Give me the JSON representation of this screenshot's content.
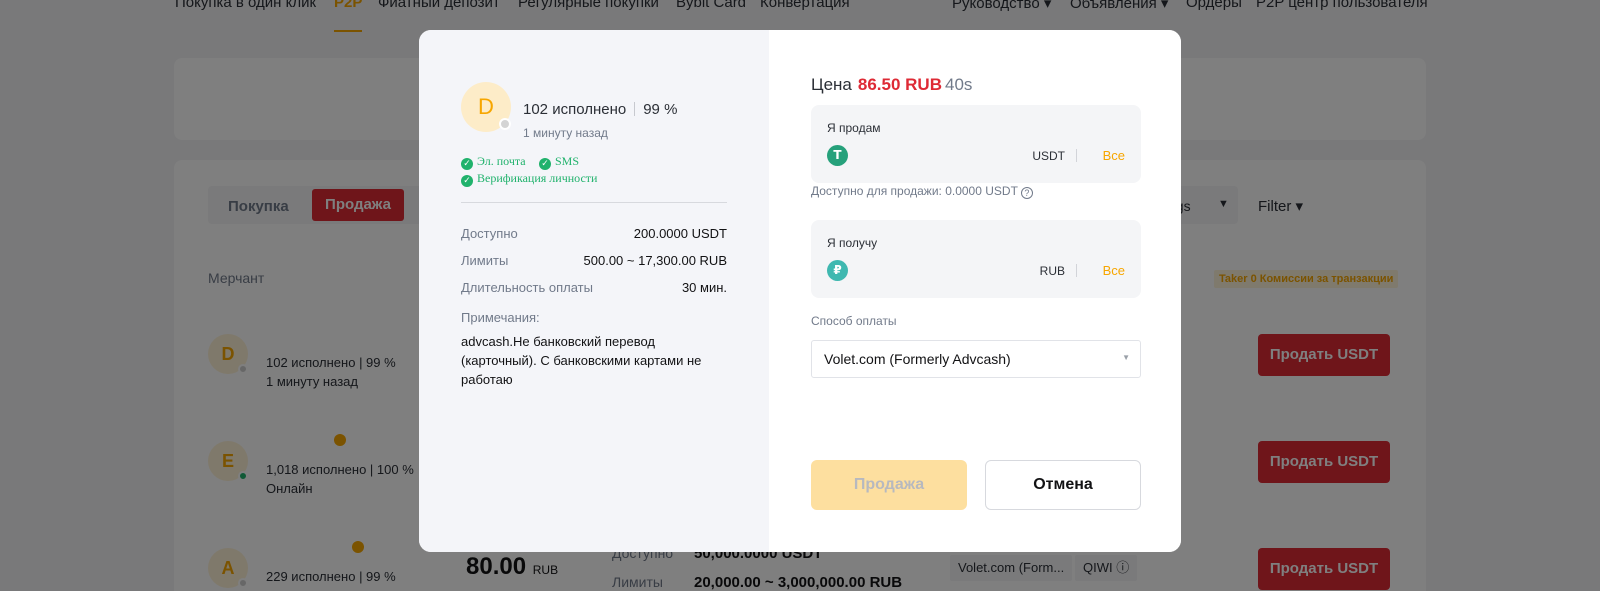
{
  "nav": {
    "items": [
      "Покупка в один клик",
      "P2P",
      "Фиатный депозит",
      "Регулярные покупки",
      "Bybit Card",
      "Конвертация"
    ],
    "right_items": [
      "Руководство ▾",
      "Объявления ▾",
      "Ордеры",
      "P2P центр пользователя"
    ]
  },
  "background": {
    "tabs": {
      "buy": "Покупка",
      "sell": "Продажа"
    },
    "ngs_fragment": "ngs",
    "filter": "Filter ▾",
    "merchant_label": "Мерчант",
    "taker_badge": "Taker 0 Комиссии за транзакции",
    "rows": [
      {
        "initial": "D",
        "stats": "102 исполнено   |   99 %",
        "sub": "1 минуту назад",
        "button": "Продать USDT"
      },
      {
        "initial": "E",
        "stats": "1,018 исполнено   |   100 %",
        "sub": "Онлайн",
        "button": "Продать USDT"
      },
      {
        "initial": "A",
        "stats": "229 исполнено   |   99 %",
        "sub": "",
        "button": "Продать USDT",
        "price": "80.00",
        "price_currency": "RUB",
        "available_label": "Доступно",
        "available_value": "50,000.0000 USDT",
        "limits_label": "Лимиты",
        "limits_value": "20,000.00 ~ 3,000,000.00 RUB",
        "payment_tags": [
          "Volet.com (Form...",
          "QIWI ⓘ"
        ]
      }
    ]
  },
  "modal": {
    "merchant": {
      "initial": "D",
      "orders": "102 исполнено",
      "rate": "99 %",
      "last_seen": "1 минуту назад",
      "verifications": [
        "Эл. почта",
        "SMS",
        "Верификация личности"
      ]
    },
    "info": [
      {
        "label": "Доступно",
        "value": "200.0000 USDT"
      },
      {
        "label": "Лимиты",
        "value": "500.00 ~ 17,300.00 RUB"
      },
      {
        "label": "Длительность оплаты",
        "value": "30 мин."
      }
    ],
    "notes_label": "Примечания:",
    "notes": "advcash.Не банковский перевод (карточный). С банковскими картами не работаю",
    "price_label": "Цена",
    "price_value": "86.50 RUB",
    "timer": "40s",
    "sell_box": {
      "label": "Я продам",
      "value": "",
      "currency": "USDT",
      "all": "Все",
      "coin_glyph": "T"
    },
    "available_for_sale": "Доступно для продажи: 0.0000 USDT",
    "receive_box": {
      "label": "Я получу",
      "value": "",
      "currency": "RUB",
      "all": "Все",
      "coin_glyph": "₽"
    },
    "payment_method_label": "Способ оплаты",
    "payment_method_value": "Volet.com (Formerly Advcash)",
    "buttons": {
      "confirm": "Продажа",
      "cancel": "Отмена"
    },
    "colors": {
      "accent": "#f7a600",
      "price_red": "#de2a35",
      "tether_green": "#26a17b",
      "ruble_teal": "#3fb8b0",
      "verified_green": "#20b26c"
    }
  }
}
